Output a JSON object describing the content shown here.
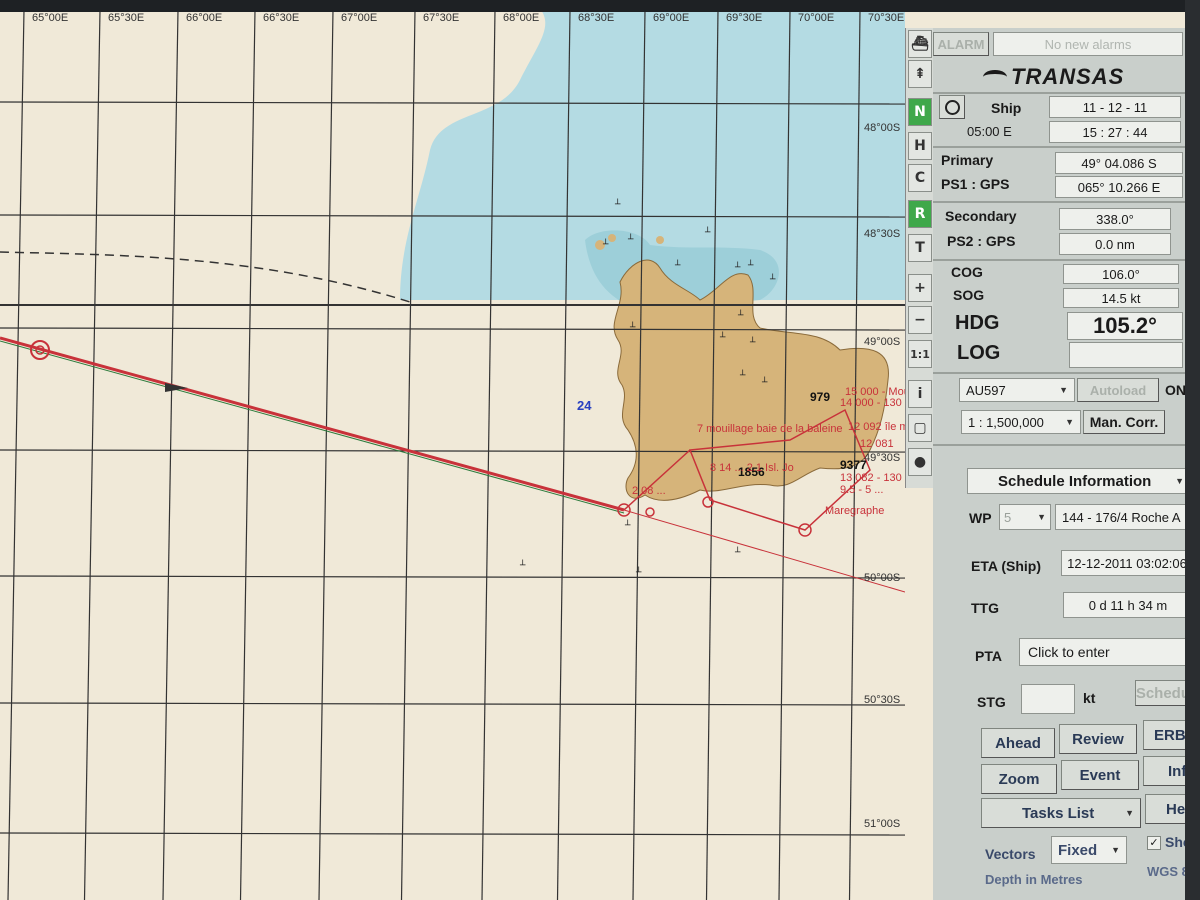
{
  "chart": {
    "longitudes": [
      "65°00E",
      "65°30E",
      "66°00E",
      "66°30E",
      "67°00E",
      "67°30E",
      "68°00E",
      "68°30E",
      "69°00E",
      "69°30E",
      "70°00E",
      "70°30E"
    ],
    "latitudes": [
      "48°00S",
      "48°30S",
      "49°00S",
      "49°30S",
      "50°00S",
      "50°30S",
      "51°00S"
    ],
    "depth_labels": [
      {
        "text": "24",
        "style": "blue"
      },
      {
        "text": "979",
        "style": "black"
      },
      {
        "text": "1856",
        "style": "black"
      },
      {
        "text": "9377",
        "style": "black"
      }
    ],
    "route_labels": [
      "15 000 - Mou",
      "14 000 - 130",
      "7 mouillage baie de la baleine",
      "12 092 île m",
      "12 081",
      "8 14 ... 2.1 Isl. Jo",
      "2 08 ... ",
      "13 082 - 130",
      "9.5 - 5 ... ",
      "Maregraphe"
    ]
  },
  "toolbar": {
    "buttons": [
      {
        "name": "ship-mode-icon",
        "glyph": "⛴",
        "active": false
      },
      {
        "name": "head-up-icon",
        "glyph": "⇞",
        "active": false
      },
      {
        "name": "north-up-icon",
        "glyph": "N",
        "active": true
      },
      {
        "name": "head-up-h-icon",
        "glyph": "H",
        "active": false
      },
      {
        "name": "course-up-icon",
        "glyph": "C",
        "active": false
      },
      {
        "name": "relative-motion-icon",
        "glyph": "R",
        "active": true
      },
      {
        "name": "true-motion-icon",
        "glyph": "T",
        "active": false
      },
      {
        "name": "zoom-in-icon",
        "glyph": "+",
        "active": false
      },
      {
        "name": "zoom-out-icon",
        "glyph": "−",
        "active": false
      },
      {
        "name": "scale-one-to-one-icon",
        "glyph": "1:1",
        "active": false
      },
      {
        "name": "info-icon",
        "glyph": "i",
        "active": false
      },
      {
        "name": "page-icon",
        "glyph": "▢",
        "active": false
      },
      {
        "name": "circle-icon",
        "glyph": "●",
        "active": false
      }
    ]
  },
  "panel": {
    "alarm_label": "ALARM",
    "alarm_status": "No new alarms",
    "brand": "TRANSAS",
    "clock_ship_label": "Ship",
    "clock_zone": "05:00 E",
    "date": "11 - 12 - 11",
    "time": "15 : 27 : 44",
    "primary_label": "Primary",
    "ps1_label": "PS1 : GPS",
    "lat": "49° 04.086 S",
    "lon": "065° 10.266 E",
    "secondary_label": "Secondary",
    "ps2_label": "PS2 : GPS",
    "secondary_bearing": "338.0°",
    "secondary_distance": "0.0 nm",
    "cog_label": "COG",
    "cog_value": "106.0°",
    "sog_label": "SOG",
    "sog_value": "14.5 kt",
    "hdg_label": "HDG",
    "hdg_value": "105.2°",
    "log_label": "LOG",
    "log_value": "",
    "chart_select": "AU597",
    "autoload_label": "Autoload",
    "on_label": "ON",
    "scale_select": "1 : 1,500,000",
    "man_corr_label": "Man. Corr.",
    "schedule_select": "Schedule Information",
    "wp_label": "WP",
    "wp_number": "5",
    "wp_name": "144 - 176/4 Roche A",
    "eta_label": "ETA (Ship)",
    "eta_value": "12-12-2011 03:02:06",
    "ttg_label": "TTG",
    "ttg_value": "0 d 11 h 34 m",
    "pta_label": "PTA",
    "pta_value": "Click to enter",
    "stg_label": "STG",
    "stg_value": "",
    "stg_unit": "kt",
    "schedule_btn": "Schedul",
    "ahead_btn": "Ahead",
    "review_btn": "Review",
    "erbl_btn": "ERBL",
    "zoom_btn": "Zoom",
    "event_btn": "Event",
    "info_btn": "Info",
    "tasks_select": "Tasks List",
    "help_btn": "Help",
    "vectors_label": "Vectors",
    "vectors_select": "Fixed",
    "show_label": "Sho",
    "depth_label": "Depth in Metres",
    "datum_label": "WGS 8"
  }
}
